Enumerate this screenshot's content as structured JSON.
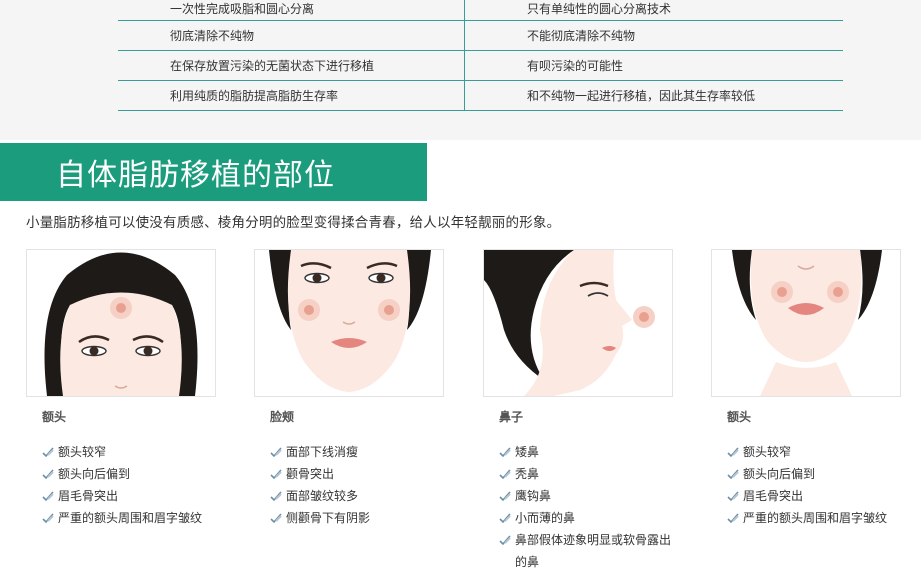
{
  "comparison_table": {
    "rows": [
      {
        "left": "一次性完成吸脂和圆心分离",
        "right": "只有单纯性的圆心分离技术"
      },
      {
        "left": "彻底清除不纯物",
        "right": "不能彻底清除不纯物"
      },
      {
        "left": "在保存放置污染的无菌状态下进行移植",
        "right": "有呗污染的可能性"
      },
      {
        "left": "利用纯质的脂肪提高脂肪生存率",
        "right": "和不纯物一起进行移植，因此其生存率较低"
      }
    ]
  },
  "section": {
    "title": "自体脂肪移植的部位",
    "intro": "小量脂肪移植可以使没有质感、棱角分明的脸型变得揉合青春，给人以年轻靓丽的形象。"
  },
  "cards": [
    {
      "title": "额头",
      "image": "forehead-face",
      "items": [
        "额头较窄",
        "额头向后偏到",
        "眉毛骨突出",
        "严重的额头周围和眉字皱纹"
      ]
    },
    {
      "title": "脸颊",
      "image": "cheek-face",
      "items": [
        "面部下线消瘦",
        "颧骨突出",
        "面部皱纹较多",
        "侧颧骨下有阴影"
      ]
    },
    {
      "title": "鼻子",
      "image": "nose-profile",
      "items": [
        "矮鼻",
        "秃鼻",
        "鹰钩鼻",
        "小而薄的鼻",
        "鼻部假体迹象明显或软骨露出的鼻"
      ]
    },
    {
      "title": "额头",
      "image": "lip-face",
      "items": [
        "额头较窄",
        "额头向后偏到",
        "眉毛骨突出",
        "严重的额头周围和眉字皱纹"
      ]
    }
  ],
  "colors": {
    "teal_line": "#3a9c97",
    "banner_green": "#1a9c7d",
    "marker": "#e8a090"
  },
  "icons": {
    "list_bullet": "pencil-check-icon"
  }
}
